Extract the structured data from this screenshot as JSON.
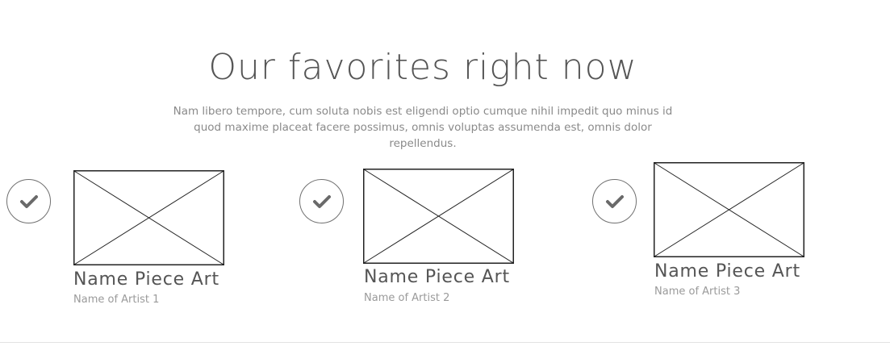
{
  "section": {
    "heading": "Our favorites right now",
    "intro": "Nam libero tempore, cum soluta nobis est eligendi optio cumque nihil impedit quo minus id quod maxime placeat facere possimus, omnis voluptas assumenda est, omnis dolor repellendus."
  },
  "items": [
    {
      "title": "Name Piece Art",
      "artist": "Name of Artist 1",
      "icon": "check-icon",
      "image": "image-placeholder-icon"
    },
    {
      "title": "Name Piece Art",
      "artist": "Name of Artist 2",
      "icon": "check-icon",
      "image": "image-placeholder-icon"
    },
    {
      "title": "Name Piece Art",
      "artist": "Name of Artist 3",
      "icon": "check-icon",
      "image": "image-placeholder-icon"
    }
  ],
  "colors": {
    "text": "#555555",
    "muted": "#8a8a8a",
    "outline": "#707070",
    "divider": "#e3e3e3"
  }
}
